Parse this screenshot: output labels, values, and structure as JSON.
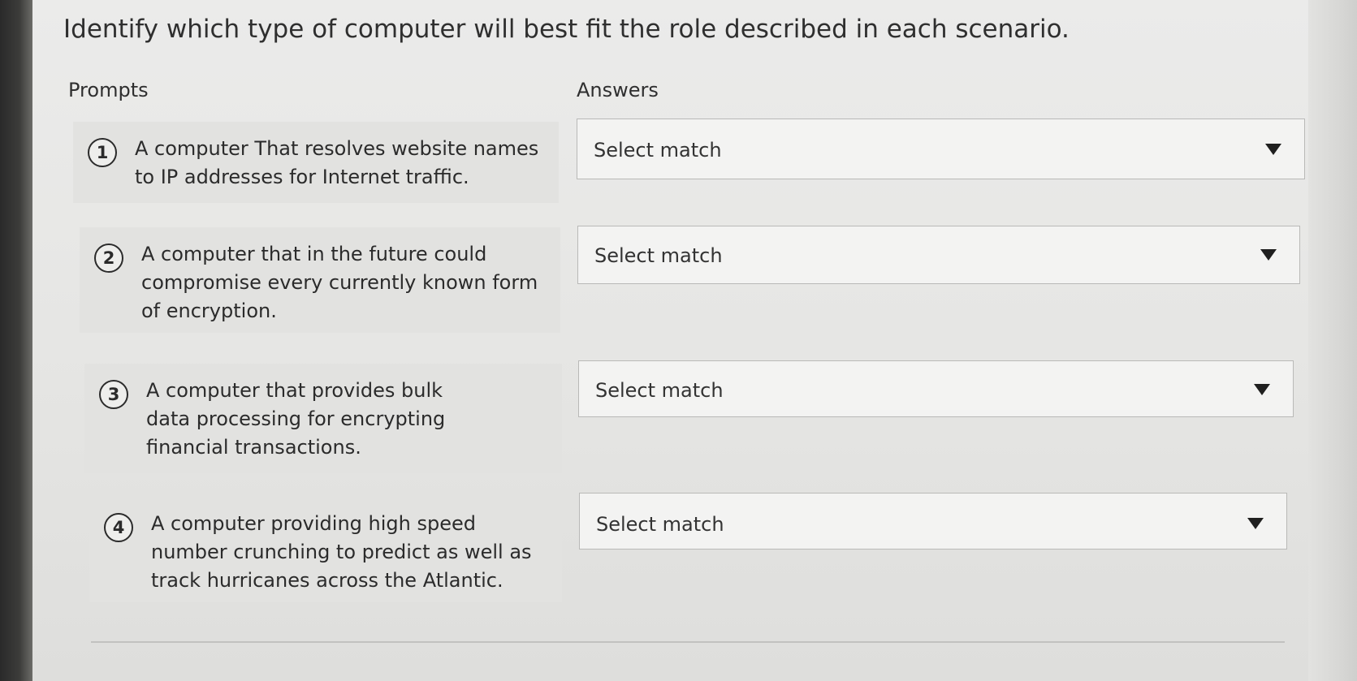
{
  "page": {
    "title": "Identify which type of computer will best fit the role described in each scenario.",
    "prompts_header": "Prompts",
    "answers_header": "Answers"
  },
  "items": [
    {
      "number": "1",
      "prompt": "A computer That resolves website names to IP addresses for Internet traffic.",
      "answer": "Select match"
    },
    {
      "number": "2",
      "prompt": "A computer that in the future could compromise every currently known form of encryption.",
      "answer": "Select match"
    },
    {
      "number": "3",
      "prompt": "A computer that provides bulk data processing for encrypting financial transactions.",
      "answer": "Select match"
    },
    {
      "number": "4",
      "prompt": "A computer providing high speed number crunching to predict as well as track hurricanes across the Atlantic.",
      "answer": "Select match"
    }
  ],
  "icons": {
    "dropdown": "chevron-down-icon"
  }
}
